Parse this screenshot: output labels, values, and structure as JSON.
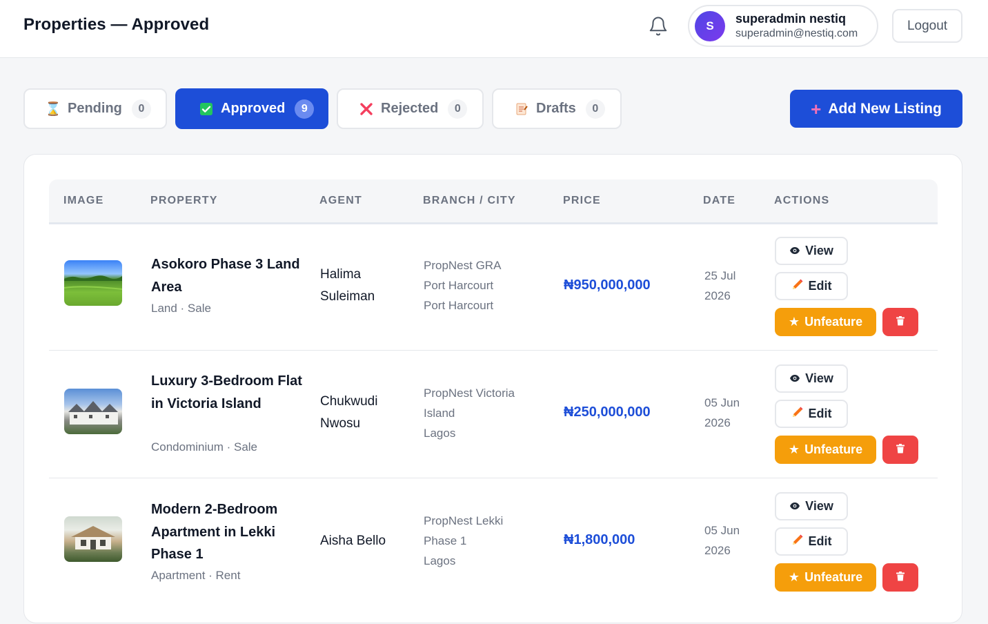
{
  "header": {
    "title": "Properties — Approved",
    "user": {
      "initial": "S",
      "name": "superadmin nestiq",
      "email": "superadmin@nestiq.com"
    },
    "logout_label": "Logout"
  },
  "tabs": [
    {
      "icon": "hourglass-icon",
      "label": "Pending",
      "count": "0",
      "active": false
    },
    {
      "icon": "check-box-icon",
      "label": "Approved",
      "count": "9",
      "active": true
    },
    {
      "icon": "cross-mark-icon",
      "label": "Rejected",
      "count": "0",
      "active": false
    },
    {
      "icon": "memo-icon",
      "label": "Drafts",
      "count": "0",
      "active": false
    }
  ],
  "add_button_label": "Add New Listing",
  "table": {
    "columns": [
      "Image",
      "Property",
      "Agent",
      "Branch / City",
      "Price",
      "Date",
      "Actions"
    ],
    "rows": [
      {
        "title": "Asokoro Phase 3 Land Area",
        "meta": "Land · Sale",
        "agent": "Halima Suleiman",
        "branch_lines": [
          "PropNest GRA",
          "Port Harcourt",
          "Port Harcourt"
        ],
        "price": "₦950,000,000",
        "date": "25 Jul 2026"
      },
      {
        "title": "Luxury 3-Bedroom Flat in Victoria Island",
        "meta": "Condominium · Sale",
        "agent": "Chukwudi Nwosu",
        "branch_lines": [
          "PropNest Victoria",
          "Island",
          "Lagos"
        ],
        "price": "₦250,000,000",
        "date": "05 Jun 2026"
      },
      {
        "title": "Modern 2-Bedroom Apartment in Lekki Phase 1",
        "meta": "Apartment · Rent",
        "agent": "Aisha Bello",
        "branch_lines": [
          "PropNest Lekki",
          "Phase 1",
          "Lagos"
        ],
        "price": "₦1,800,000",
        "date": "05 Jun 2026"
      }
    ],
    "actions": {
      "view": "View",
      "edit": "Edit",
      "unfeature": "Unfeature"
    }
  },
  "colors": {
    "primary": "#1d4ed8",
    "warning": "#f59e0b",
    "danger": "#ef4444"
  }
}
